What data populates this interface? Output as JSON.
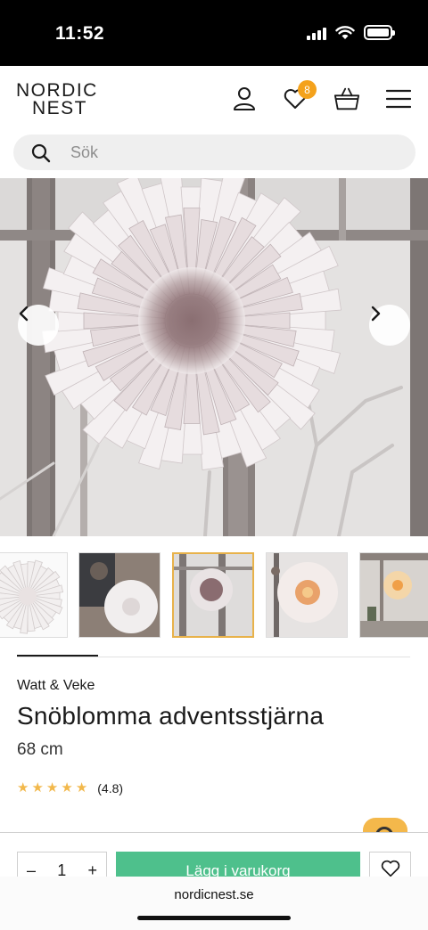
{
  "status_bar": {
    "time": "11:52"
  },
  "header": {
    "logo_line1": "NORDIC",
    "logo_line2": "NEST",
    "wishlist_count": "8"
  },
  "search": {
    "placeholder": "Sök"
  },
  "gallery": {
    "thumbnail_count": 5,
    "active_index": 2
  },
  "product": {
    "brand": "Watt & Veke",
    "title": "Snöblomma adventsstjärna",
    "size": "68 cm",
    "rating_stars": 5,
    "rating_value": "(4.8)"
  },
  "purchase": {
    "qty_minus": "–",
    "quantity": "1",
    "qty_plus": "+",
    "add_to_cart": "Lägg i varukorg"
  },
  "browser": {
    "url": "nordicnest.se"
  },
  "colors": {
    "accent_green": "#4ec08c",
    "badge_orange": "#f4a21c",
    "active_border": "#e8b24a"
  }
}
